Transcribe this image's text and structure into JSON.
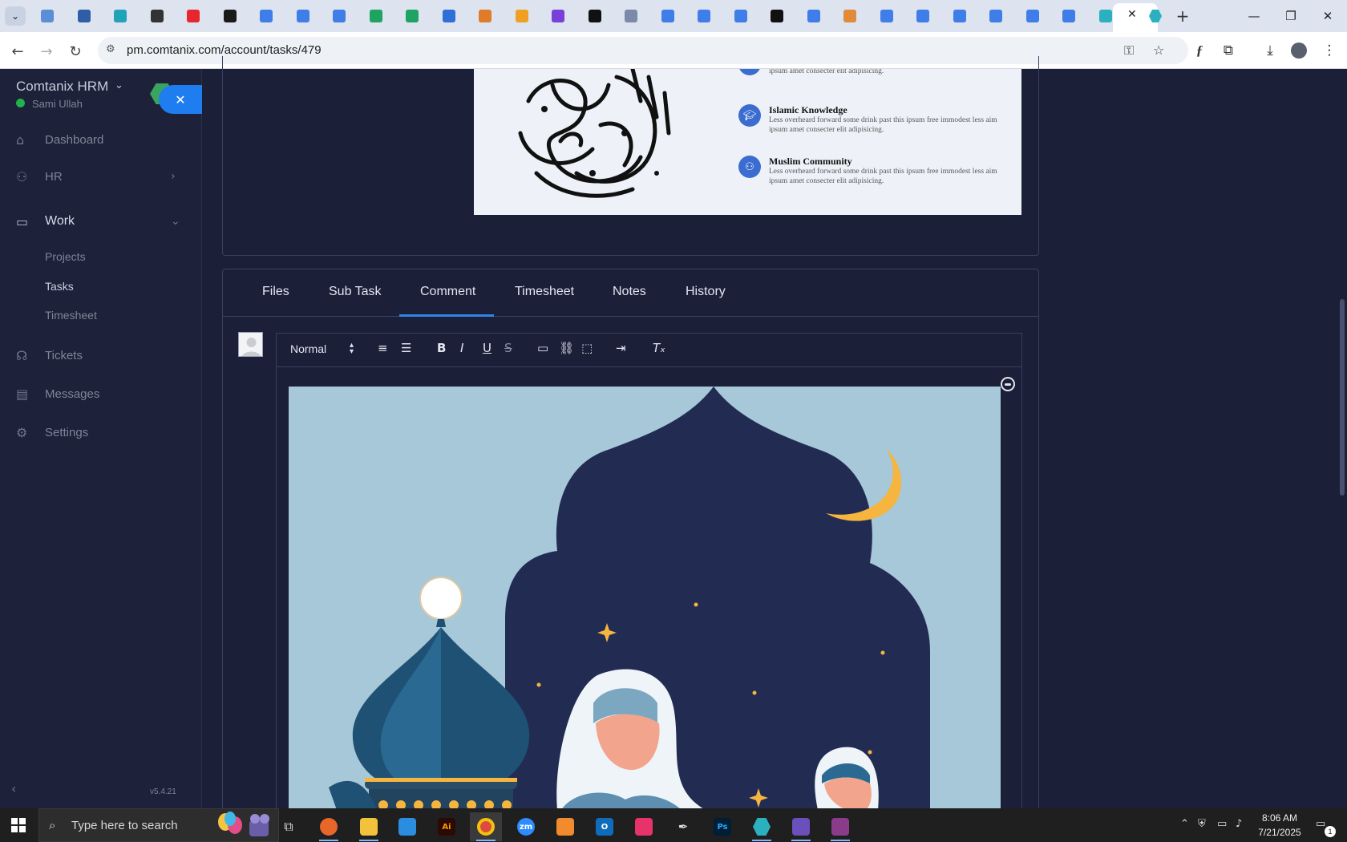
{
  "browser": {
    "url": "pm.comtanix.com/account/tasks/479",
    "tab_favicon_colors": [
      "#5b8ed6",
      "#2f5ea8",
      "#1fa3b8",
      "#333333",
      "#e8262d",
      "#1a1a1a",
      "#3f7ee8",
      "#3f7ee8",
      "#3f7ee8",
      "#1ea362",
      "#1ea362",
      "#2e6fd8",
      "#e07b2a",
      "#f0a020",
      "#7a3fd8",
      "#111111",
      "#7a8aa8",
      "#3f7ee8",
      "#3f7ee8",
      "#3f7ee8",
      "#111111",
      "#3f7ee8",
      "#e08a3a",
      "#3f7ee8",
      "#3f7ee8",
      "#3f7ee8",
      "#3f7ee8",
      "#3f7ee8",
      "#3f7ee8",
      "#2bb0c0",
      "#2bb0c0"
    ]
  },
  "sidebar": {
    "brand": "Comtanix HRM",
    "user": "Sami Ullah",
    "menu": [
      {
        "label": "Dashboard",
        "icon": "home-icon"
      },
      {
        "label": "HR",
        "icon": "users-icon"
      },
      {
        "label": "Work",
        "icon": "briefcase-icon"
      },
      {
        "label": "Tickets",
        "icon": "headset-icon"
      },
      {
        "label": "Messages",
        "icon": "message-icon"
      },
      {
        "label": "Settings",
        "icon": "gear-icon"
      }
    ],
    "work_submenu": [
      "Projects",
      "Tasks",
      "Timesheet"
    ],
    "version": "v5.4.21"
  },
  "promo": {
    "partial_text": "ipsum amet consecter elit adipisicing.",
    "features": [
      {
        "title": "Islamic Knowledge",
        "desc": "Less overheard forward some drink past this ipsum free immodest less aim ipsum amet consecter elit adipisicing."
      },
      {
        "title": "Muslim Community",
        "desc": "Less overheard forward some drink past this ipsum free immodest less aim ipsum amet consecter elit adipisicing."
      }
    ]
  },
  "task_tabs": {
    "items": [
      "Files",
      "Sub Task",
      "Comment",
      "Timesheet",
      "Notes",
      "History"
    ],
    "active": "Comment"
  },
  "editor": {
    "format_select": "Normal"
  },
  "taskbar": {
    "search_placeholder": "Type here to search",
    "time": "8:06 AM",
    "date": "7/21/2025",
    "notification_count": "1"
  }
}
